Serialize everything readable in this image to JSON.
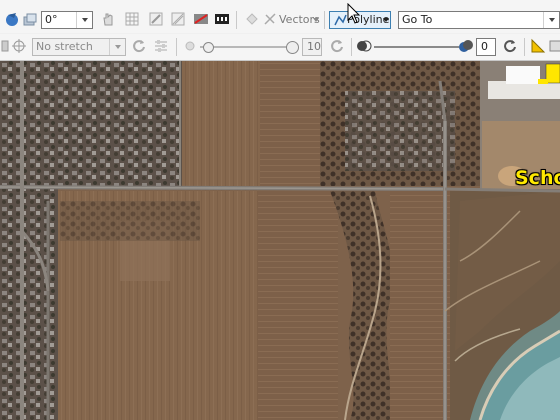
{
  "toolbar1": {
    "rotation_value": "0°",
    "vectors_label": "Vectors",
    "polyline_label": "Polyline",
    "goto_value": "Go To"
  },
  "toolbar2": {
    "stretch_value": "No stretch",
    "brightness_value": "10",
    "transparency_value": "0"
  },
  "map": {
    "school_label": "Scho"
  },
  "icons": [
    "globe-arrow-icon",
    "layers-icon",
    "hand-pan-icon",
    "grid-icon",
    "annotate-icon",
    "no-image-icon",
    "film-icon",
    "vectors-icon",
    "polyline-icon",
    "crosshair-icon",
    "refresh-icon",
    "sliders-icon",
    "brightness-icon",
    "transparency-icon",
    "swap-icon",
    "chart-icon",
    "mouse-cursor-icon"
  ],
  "colors": {
    "school_label": "#ffe900",
    "toolbar_bg": "#f5f5f5",
    "polyline_highlight": "#e5f1fb"
  }
}
